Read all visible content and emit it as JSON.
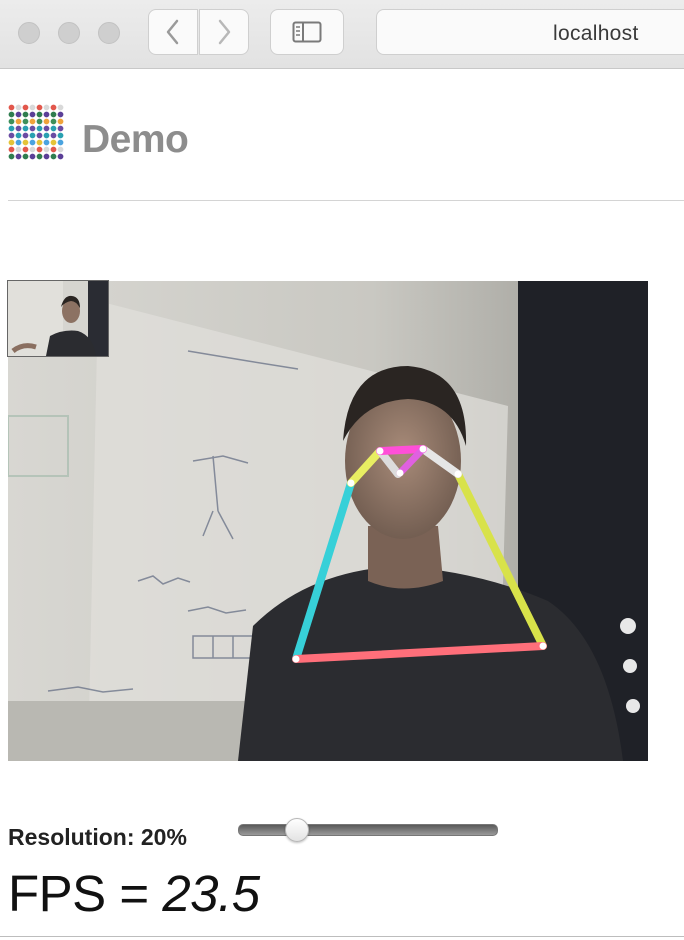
{
  "browser": {
    "url": "localhost",
    "traffic_lights": [
      "close",
      "minimize",
      "zoom"
    ]
  },
  "page": {
    "title": "Demo",
    "logo_icon": "dot-grid-logo-icon"
  },
  "video": {
    "skeleton_colors": {
      "left_arm": "#37d0d8",
      "right_arm": "#d8e24a",
      "shoulders": "#ff6f7a",
      "nose": "#ff4fd8",
      "eyes_left": "#e8ee62",
      "eyes_right": "#e6e6e6"
    }
  },
  "controls": {
    "resolution_label": "Resolution: 20%",
    "resolution_value": 0.2,
    "fps_prefix": "FPS = ",
    "fps_value": "23.5"
  }
}
